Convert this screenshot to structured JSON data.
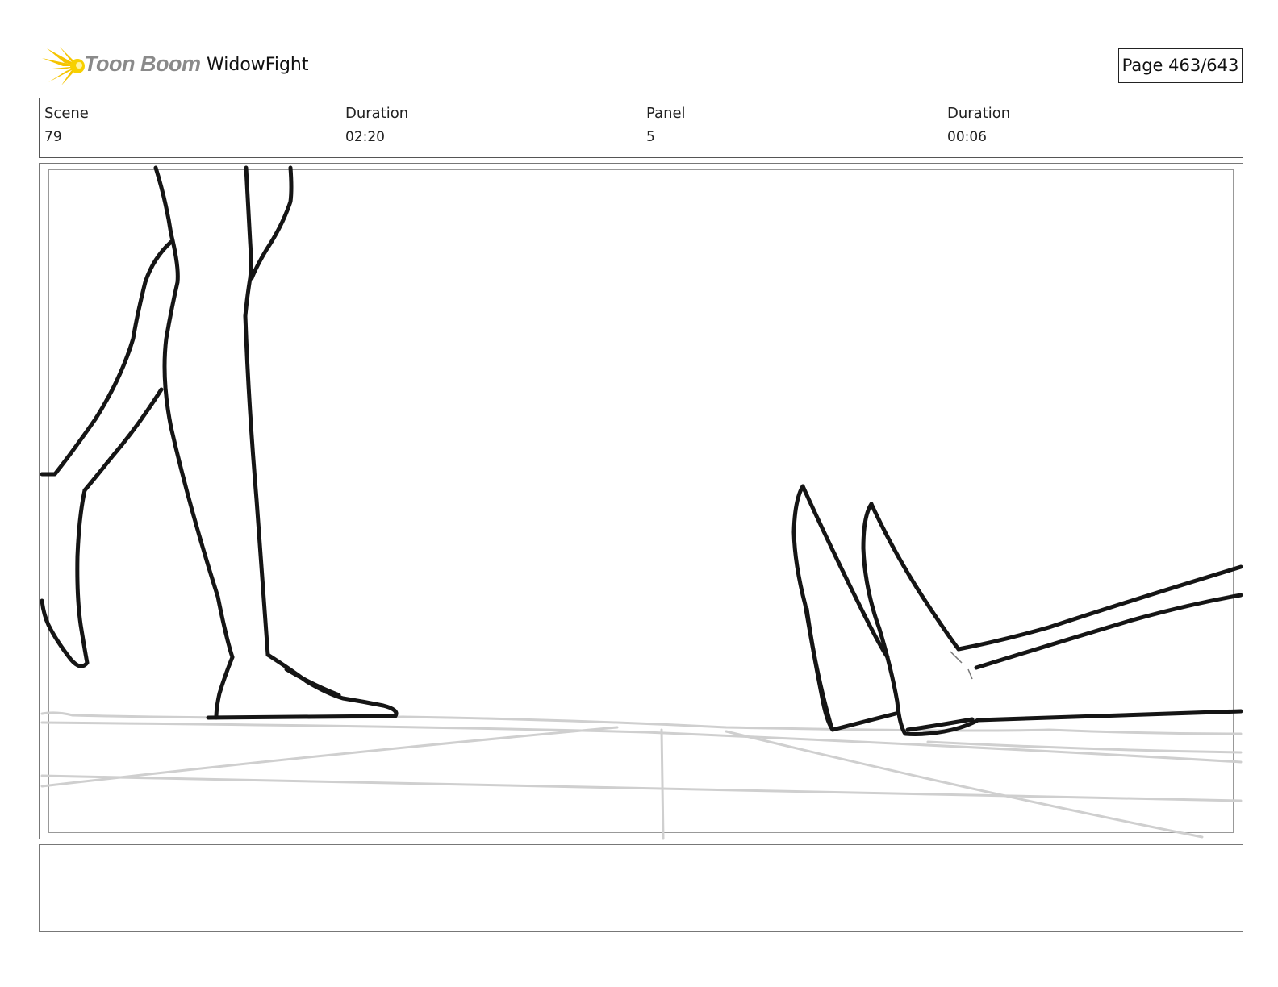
{
  "header": {
    "logo_text": "Toon Boom",
    "project_title": "WidowFight",
    "page_label": "Page 463/643"
  },
  "info": {
    "scene_label": "Scene",
    "scene_value": "79",
    "scene_duration_label": "Duration",
    "scene_duration_value": "02:20",
    "panel_label": "Panel",
    "panel_value": "5",
    "panel_duration_label": "Duration",
    "panel_duration_value": "00:06"
  },
  "colors": {
    "logo_yellow": "#f5c400",
    "logo_gray": "#8a8a8a",
    "ink": "#151515",
    "guide_gray": "#c8c8c8"
  },
  "icons": {
    "logo": "toon-boom-burst-icon"
  },
  "notes": {
    "text": ""
  }
}
